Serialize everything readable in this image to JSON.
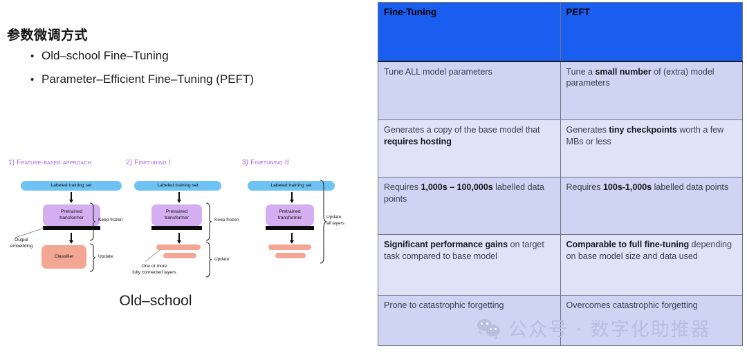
{
  "slide": {
    "title": "参数微调方式",
    "bullets": [
      {
        "marker": "•",
        "text": "Old–school Fine–Tuning"
      },
      {
        "marker": "•",
        "text": "Parameter–Efficient Fine–Tuning (PEFT)"
      }
    ],
    "caption": "Old–school"
  },
  "diagram": {
    "columns": [
      {
        "num": "1)",
        "title": "Feature-based approach",
        "dataset_label": "Labeled training set",
        "model_label": "Pretrained\ntransformer",
        "model_label_line1": "Pretrained",
        "model_label_line2": "transformer",
        "classifier_label": "Classifier",
        "bracket_top_label": "Keep frozen",
        "bracket_bottom_label": "Update",
        "note_line1": "Output",
        "note_line2": "embedding"
      },
      {
        "num": "2)",
        "title": "Finetuning I",
        "dataset_label": "Labeled training set",
        "model_label_line1": "Pretrained",
        "model_label_line2": "transformer",
        "bracket_top_label": "Keep frozen",
        "bracket_bottom_label": "Update",
        "note_line1": "One or more",
        "note_line2": "fully connected layers"
      },
      {
        "num": "3)",
        "title": "Finetuning II",
        "dataset_label": "Labeled training set",
        "model_label_line1": "Pretrained",
        "model_label_line2": "transformer",
        "bracket_label_line1": "Update",
        "bracket_label_line2": "all layers"
      }
    ]
  },
  "table": {
    "headers": [
      "Fine-Tuning",
      "PEFT"
    ],
    "rows": [
      {
        "left": [
          {
            "t": "Tune ALL model parameters",
            "b": false
          }
        ],
        "right": [
          {
            "t": "Tune a ",
            "b": false
          },
          {
            "t": "small number",
            "b": true
          },
          {
            "t": " of (extra) model parameters",
            "b": false
          }
        ]
      },
      {
        "left": [
          {
            "t": "Generates a copy of the base model that ",
            "b": false
          },
          {
            "t": "requires hosting",
            "b": true
          }
        ],
        "right": [
          {
            "t": "Generates ",
            "b": false
          },
          {
            "t": "tiny checkpoints",
            "b": true
          },
          {
            "t": " worth a few MBs or less",
            "b": false
          }
        ]
      },
      {
        "left": [
          {
            "t": "Requires ",
            "b": false
          },
          {
            "t": "1,000s – 100,000s",
            "b": true
          },
          {
            "t": " labelled data points",
            "b": false
          }
        ],
        "right": [
          {
            "t": "Requires ",
            "b": false
          },
          {
            "t": "100s-1,000s",
            "b": true
          },
          {
            "t": " labelled data points",
            "b": false
          }
        ]
      },
      {
        "left": [
          {
            "t": "Significant performance gains",
            "b": true
          },
          {
            "t": " on target task compared to base model",
            "b": false
          }
        ],
        "right": [
          {
            "t": "Comparable to full fine-tuning",
            "b": true
          },
          {
            "t": " depending on base model size and data used",
            "b": false
          }
        ]
      },
      {
        "left": [
          {
            "t": "Prone to catastrophic forgetting",
            "b": false
          }
        ],
        "right": [
          {
            "t": "Overcomes catastrophic forgetting",
            "b": false
          }
        ]
      }
    ]
  },
  "watermark": {
    "icon": "wechat-icon",
    "text": "公众号 · 数字化助推器"
  },
  "colors": {
    "header_blue": "#1a5ef0",
    "row_light": "#e0e3f8",
    "row_dark": "#ced4f2",
    "title_purple": "#a05ce8",
    "dataset_blue": "#6ec3f4",
    "model_purple": "#d4aef0",
    "classifier_salmon": "#f4a694",
    "watermark_gray": "#b9bfdf"
  }
}
